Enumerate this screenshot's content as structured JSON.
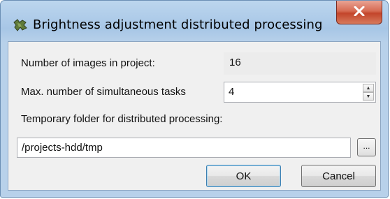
{
  "window": {
    "title": "Brightness adjustment distributed processing",
    "icons": {
      "app": "puzzle-icon",
      "close": "close-icon"
    },
    "accent_color": "#c3452b"
  },
  "form": {
    "images_label": "Number of images in project:",
    "images_value": "16",
    "tasks_label": "Max. number of simultaneous tasks",
    "tasks_value": "4",
    "folder_label": "Temporary folder for distributed processing:",
    "folder_value": "/projects-hdd/tmp",
    "browse_label": "..."
  },
  "buttons": {
    "ok": "OK",
    "cancel": "Cancel"
  }
}
